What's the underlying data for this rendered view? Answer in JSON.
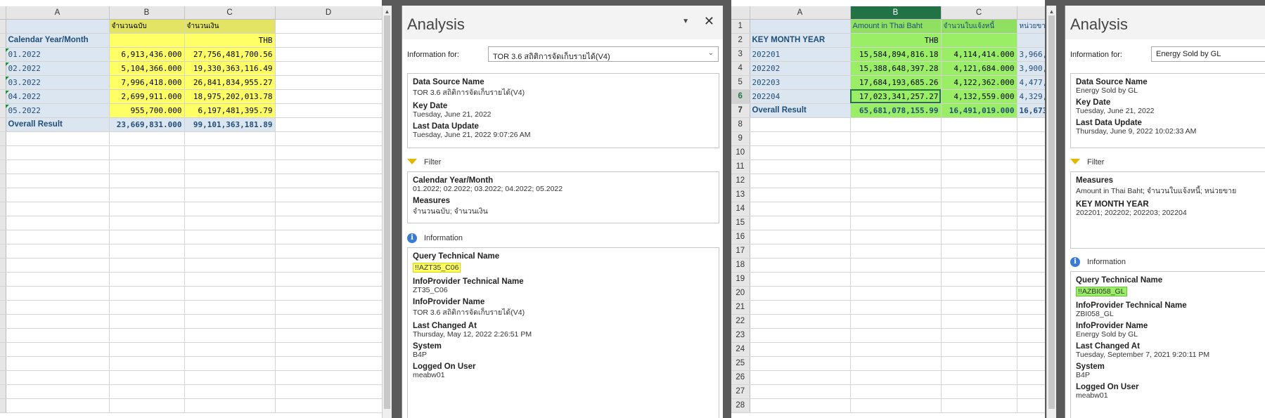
{
  "left_sheet": {
    "columns": [
      "A",
      "B",
      "C",
      "D"
    ],
    "header_row1": [
      "",
      "จำนวนฉบับ",
      "จำนวนเงิน",
      ""
    ],
    "header_row2": [
      "Calendar Year/Month",
      "",
      "THB",
      ""
    ],
    "rows": [
      [
        "01.2022",
        "6,913,436.000",
        "27,756,481,700.56"
      ],
      [
        "02.2022",
        "5,104,366.000",
        "19,330,363,116.49"
      ],
      [
        "03.2022",
        "7,996,418.000",
        "26,841,834,955.27"
      ],
      [
        "04.2022",
        "2,699,911.000",
        "18,975,202,013.78"
      ],
      [
        "05.2022",
        "955,700.000",
        "6,197,481,395.79"
      ]
    ],
    "total": [
      "Overall Result",
      "23,669,831.000",
      "99,101,363,181.89"
    ]
  },
  "left_pane": {
    "title": "Analysis",
    "info_for_label": "Information for:",
    "info_for_value": "TOR 3.6 สถิติการจัดเก็บรายได้(V4)",
    "meta": [
      {
        "k": "Data Source Name",
        "v": "TOR 3.6 สถิติการจัดเก็บรายได้(V4)"
      },
      {
        "k": "Key Date",
        "v": "Tuesday, June 21, 2022"
      },
      {
        "k": "Last Data Update",
        "v": "Tuesday, June 21, 2022 9:07:26 AM"
      }
    ],
    "filter_label": "Filter",
    "filter": [
      {
        "k": "Calendar Year/Month",
        "v": "01.2022; 02.2022; 03.2022; 04.2022; 05.2022"
      },
      {
        "k": "Measures",
        "v": "จำนวนฉบับ; จำนวนเงิน"
      }
    ],
    "information_label": "Information",
    "information": [
      {
        "k": "Query Technical Name",
        "v": "!!AZT35_C06"
      },
      {
        "k": "InfoProvider Technical Name",
        "v": "ZT35_C06"
      },
      {
        "k": "InfoProvider Name",
        "v": "TOR 3.6 สถิติการจัดเก็บรายได้(V4)"
      },
      {
        "k": "Last Changed At",
        "v": "Thursday, May 12, 2022 2:26:51 PM"
      },
      {
        "k": "System",
        "v": "B4P"
      },
      {
        "k": "Logged On User",
        "v": "meabw01"
      }
    ]
  },
  "right_sheet": {
    "columns": [
      "A",
      "B",
      "C",
      ""
    ],
    "header_row1": [
      "",
      "Amount in Thai Baht",
      "จำนวนใบแจ้งหนี้",
      "หน่วยขาย"
    ],
    "header_row2": [
      "KEY MONTH YEAR",
      "THB",
      "",
      ""
    ],
    "rows": [
      [
        "202201",
        "15,584,894,816.18",
        "4,114,414.000",
        "3,966,..."
      ],
      [
        "202202",
        "15,388,648,397.28",
        "4,121,684.000",
        "3,900,..."
      ],
      [
        "202203",
        "17,684,193,685.26",
        "4,122,362.000",
        "4,477,..."
      ],
      [
        "202204",
        "17,023,341,257.27",
        "4,132,559.000",
        "4,329,..."
      ]
    ],
    "total": [
      "Overall Result",
      "65,681,078,155.99",
      "16,491,019.000",
      "16,673,0..."
    ],
    "row_numbers": [
      "1",
      "2",
      "3",
      "4",
      "5",
      "6",
      "7",
      "8",
      "9",
      "10",
      "11",
      "12",
      "13",
      "14",
      "15",
      "16",
      "17",
      "18",
      "19",
      "20",
      "21",
      "22",
      "23",
      "24",
      "25",
      "26",
      "27",
      "28"
    ]
  },
  "right_pane": {
    "title": "Analysis",
    "info_for_label": "Information for:",
    "info_for_value": "Energy Sold by GL",
    "meta": [
      {
        "k": "Data Source Name",
        "v": "Energy Sold by GL"
      },
      {
        "k": "Key Date",
        "v": "Tuesday, June 21, 2022"
      },
      {
        "k": "Last Data Update",
        "v": "Thursday, June 9, 2022 10:02:33 AM"
      }
    ],
    "filter_label": "Filter",
    "filter": [
      {
        "k": "Measures",
        "v": "Amount in Thai Baht; จำนวนใบแจ้งหนี้; หน่วยขาย"
      },
      {
        "k": "KEY MONTH YEAR",
        "v": "202201; 202202; 202203; 202204"
      }
    ],
    "information_label": "Information",
    "information": [
      {
        "k": "Query Technical Name",
        "v": "!!AZBI058_GL"
      },
      {
        "k": "InfoProvider Technical Name",
        "v": "ZBI058_GL"
      },
      {
        "k": "InfoProvider Name",
        "v": "Energy Sold by GL"
      },
      {
        "k": "Last Changed At",
        "v": "Tuesday, September 7, 2021 9:20:11 PM"
      },
      {
        "k": "System",
        "v": "B4P"
      },
      {
        "k": "Logged On User",
        "v": "meabw01"
      }
    ]
  },
  "colors": {
    "highlight_yellow": "#ffff66",
    "highlight_green": "#99ee66",
    "dimension_blue": "#dce6f1",
    "excel_green": "#217346"
  },
  "icons": [
    "funnel-icon",
    "info-icon",
    "chevron-down-icon",
    "close-icon",
    "scroll-up-arrow-icon"
  ]
}
